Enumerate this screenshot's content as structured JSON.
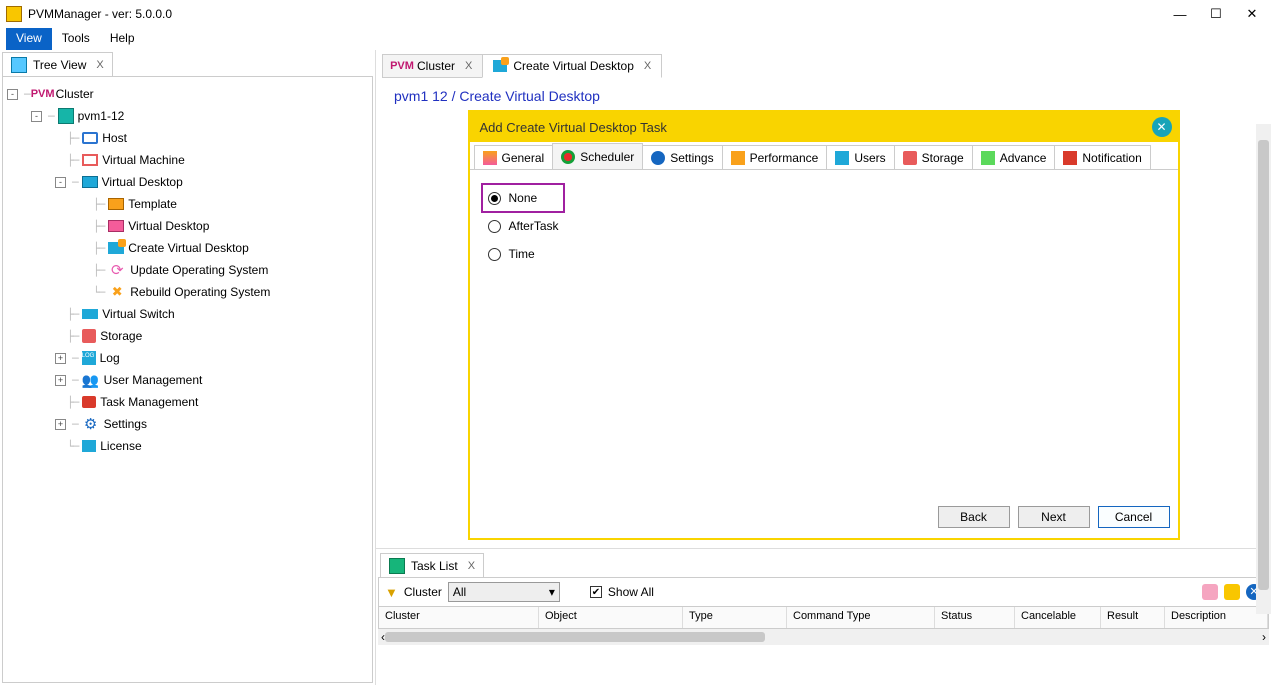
{
  "window": {
    "title": "PVMManager - ver: 5.0.0.0"
  },
  "menu": {
    "view": "View",
    "tools": "Tools",
    "help": "Help"
  },
  "leftTab": {
    "label": "Tree View"
  },
  "tree": {
    "root": "Cluster",
    "node": "pvm1-12",
    "host": "Host",
    "vm": "Virtual Machine",
    "vd": "Virtual Desktop",
    "tpl": "Template",
    "vd2": "Virtual Desktop",
    "cvd": "Create Virtual Desktop",
    "upd": "Update Operating System",
    "reb": "Rebuild Operating System",
    "vs": "Virtual Switch",
    "stor": "Storage",
    "log": "Log",
    "um": "User Management",
    "tm": "Task Management",
    "set": "Settings",
    "lic": "License"
  },
  "contentTabs": {
    "cluster": "Cluster",
    "cvd": "Create Virtual Desktop"
  },
  "breadcrumb": "pvm1 12 / Create Virtual Desktop",
  "dialog": {
    "title": "Add Create Virtual Desktop Task",
    "tabs": {
      "general": "General",
      "scheduler": "Scheduler",
      "settings": "Settings",
      "performance": "Performance",
      "users": "Users",
      "storage": "Storage",
      "advance": "Advance",
      "notification": "Notification"
    },
    "options": {
      "none": "None",
      "after": "AfterTask",
      "time": "Time"
    },
    "buttons": {
      "back": "Back",
      "next": "Next",
      "cancel": "Cancel"
    }
  },
  "taskList": {
    "tab": "Task List",
    "filterLabel": "Cluster",
    "filterValue": "All",
    "showAll": "Show All",
    "cols": {
      "cluster": "Cluster",
      "object": "Object",
      "type": "Type",
      "cmd": "Command Type",
      "status": "Status",
      "cancel": "Cancelable",
      "result": "Result",
      "desc": "Description"
    }
  }
}
